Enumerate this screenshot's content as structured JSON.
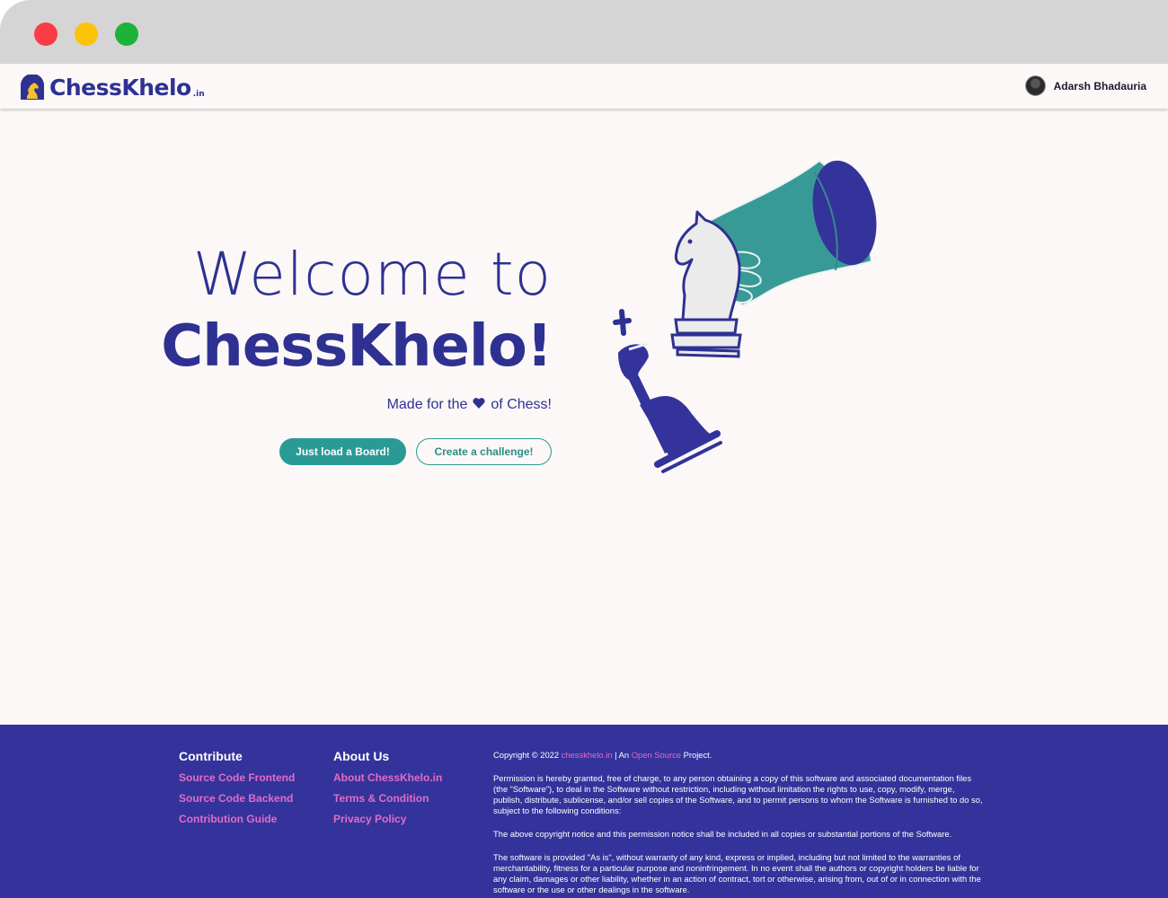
{
  "nav": {
    "logo_text": "ChessKhelo",
    "logo_suffix": ".in",
    "username": "Adarsh Bhadauria"
  },
  "hero": {
    "welcome": "Welcome to",
    "brand": "ChessKhelo!",
    "tagline_before": "Made for the",
    "tagline_after": "of Chess!",
    "primary_button": "Just load a Board!",
    "secondary_button": "Create a challenge!"
  },
  "footer": {
    "contribute": {
      "title": "Contribute",
      "links": [
        "Source Code Frontend",
        "Source Code Backend",
        "Contribution Guide"
      ]
    },
    "about": {
      "title": "About Us",
      "links": [
        "About ChessKhelo.in",
        "Terms & Condition",
        "Privacy Policy"
      ]
    },
    "copyright": {
      "prefix": "Copyright © 2022",
      "site_link": "chesskhelo.in",
      "middle": "| An",
      "oss_link": "Open Source",
      "suffix": "Project."
    },
    "license_paragraphs": [
      "Permission is hereby granted, free of charge, to any person obtaining a copy of this software and associated documentation files (the “Software”), to deal in the Software without restriction, including without limitation the rights to use, copy, modify, merge, publish, distribute, sublicense, and/or sell copies of the Software, and to permit persons to whom the Software is furnished to do so, subject to the following conditions:",
      "The above copyright notice and this permission notice shall be included in all copies or substantial portions of the Software.",
      "The software is provided \"As is\", without warranty of any kind, express or implied, including but not limited to the warranties of merchantability, fitness for a particular purpose and noninfringement. In no event shall the authors or copyright holders be liable for any claim, damages or other liability, whether in an action of contract, tort or otherwise, arising from, out of or in connection with the software or the use or other dealings in the software."
    ]
  },
  "colors": {
    "brand": "#2e3192",
    "accent": "#2a9a94",
    "link": "#e46bc6",
    "footer_bg": "#33339b",
    "page_bg": "#fcf8f7"
  },
  "icons": {
    "logo": "knight-logo-icon",
    "heart": "heart-icon",
    "hero": "hand-moving-knight-illustration"
  }
}
